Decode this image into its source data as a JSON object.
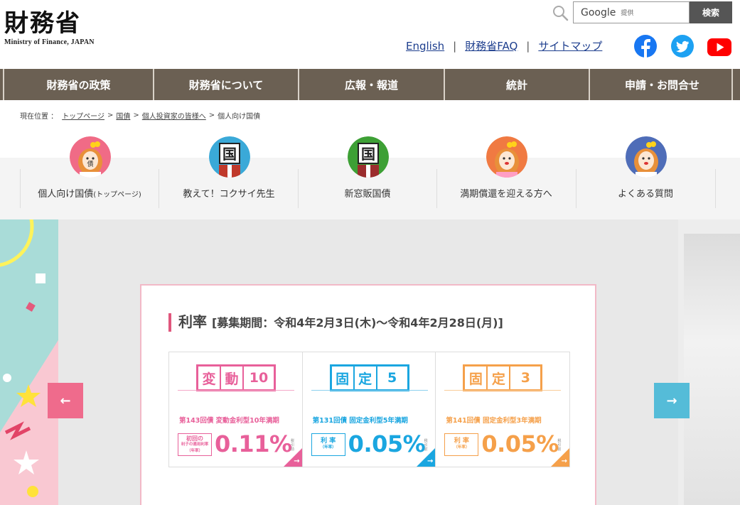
{
  "header": {
    "logo_kanji": "財務省",
    "logo_en": "Ministry of Finance, JAPAN",
    "search": {
      "brand": "Google",
      "provided": "提供",
      "button": "検索"
    },
    "links": [
      {
        "label": "English"
      },
      {
        "label": "財務省FAQ"
      },
      {
        "label": "サイトマップ"
      }
    ],
    "link_separator": "|",
    "social": [
      "facebook-icon",
      "twitter-icon",
      "youtube-icon"
    ]
  },
  "nav": {
    "items": [
      {
        "label": "財務省の政策"
      },
      {
        "label": "財務省について"
      },
      {
        "label": "広報・報道"
      },
      {
        "label": "統計"
      },
      {
        "label": "申請・お問合せ"
      }
    ]
  },
  "breadcrumb": {
    "prefix": "現在位置 ：",
    "items": [
      "トップページ",
      "国債",
      "個人投資家の皆様へ",
      "個人向け国債"
    ],
    "separator": ">"
  },
  "menu": {
    "items": [
      {
        "label": "個人向け国債",
        "label_small": "(トップページ)",
        "avatar_color": "#f06b86"
      },
      {
        "label": "教えて！コクサイ先生",
        "label_small": "",
        "avatar_color": "#3aa9d8"
      },
      {
        "label": "新窓販国債",
        "label_small": "",
        "avatar_color": "#3da035"
      },
      {
        "label": "満期償還を迎える方へ",
        "label_small": "",
        "avatar_color": "#f07a42"
      },
      {
        "label": "よくある質問",
        "label_small": "",
        "avatar_color": "#4f6db8"
      }
    ]
  },
  "banner": {
    "title": "利率",
    "period": "[募集期間：令和4年2月3日(木)〜令和4年2月28日(月)]",
    "prev_arrow": "←",
    "next_arrow": "→",
    "rates": [
      {
        "badge": [
          "変",
          "動",
          "10"
        ],
        "desc": "第143回債 変動金利型10年満期",
        "label_lines": [
          "初回の",
          "利子の適用利率",
          "（年率）"
        ],
        "value": "0.11%",
        "note": "税引前",
        "color": "#e8609a"
      },
      {
        "badge": [
          "固",
          "定",
          "5"
        ],
        "desc": "第131回債 固定金利型5年満期",
        "label_lines": [
          "利 率",
          "（年率）"
        ],
        "value": "0.05%",
        "note": "税引前",
        "color": "#1aa6e0"
      },
      {
        "badge": [
          "固",
          "定",
          "3"
        ],
        "desc": "第141回債 固定金利型3年満期",
        "label_lines": [
          "利 率",
          "（年率）"
        ],
        "value": "0.05%",
        "note": "税引前",
        "color": "#f5a04a"
      }
    ]
  },
  "colors": {
    "nav_bg": "#6b6053",
    "link": "#1d3e8e",
    "prev_btn": "#ef6b8c",
    "next_btn": "#55bcd8"
  }
}
